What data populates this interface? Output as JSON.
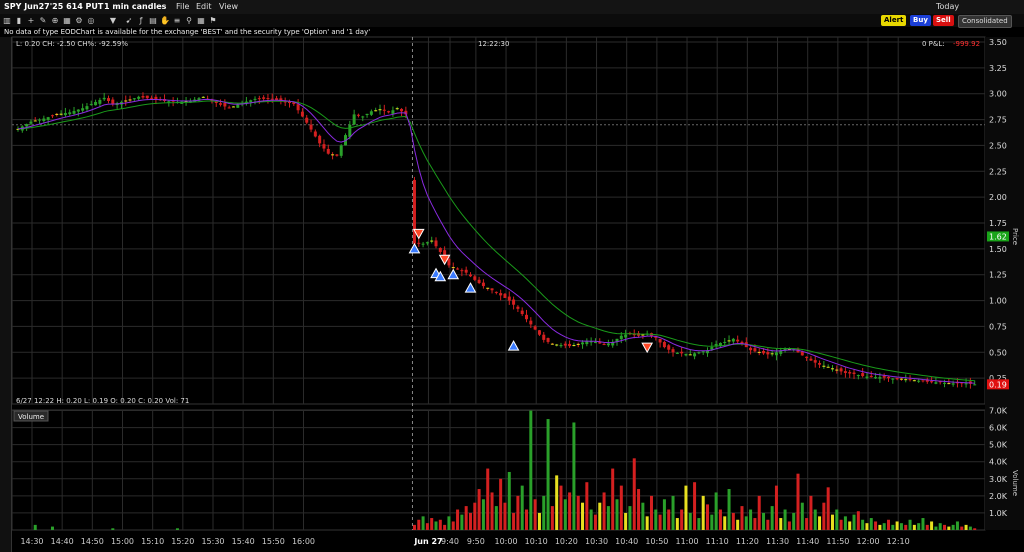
{
  "window": {
    "symbol": "SPY Jun27'25 614 PUT",
    "interval": "1 min candles",
    "menu": [
      "File",
      "Edit",
      "View"
    ],
    "today_label": "Today",
    "consolidated_label": "Consolidated"
  },
  "toolbar": {
    "alert": "Alert",
    "buy": "Buy",
    "sell": "Sell"
  },
  "notice": "No data of type EODChart is available for the exchange 'BEST' and the security type 'Option' and '1 day'",
  "price_panel": {
    "stats": "L: 0.20 CH: -2.50 CH%: -92.59%",
    "cursor_time": "12:22:30",
    "pnl_prefix": "0 P&L:",
    "pnl_value": "-999.92",
    "ohlc_footer": "6/27 12:22  H: 0.20  L: 0.19  O: 0.20  C: 0.20  Vol: 71",
    "last_price_tag": "0.19",
    "green_tag": "1.62",
    "axis_title": "Price"
  },
  "volume_panel": {
    "title": "Volume",
    "axis_title": "Volume"
  },
  "colors": {
    "up": "#2aa02a",
    "down": "#d42020",
    "neutral": "#e8e020",
    "ema_fast": "#8a2be2",
    "ema_slow": "#1a9a1a",
    "sell_tag": "#e01010",
    "grid": "#2b2b2b"
  },
  "chart_data": {
    "type": "candlestick",
    "x_tick_labels": [
      "14:30",
      "14:40",
      "14:50",
      "15:00",
      "15:10",
      "15:20",
      "15:30",
      "15:40",
      "15:50",
      "16:00",
      "Jun 27",
      "9:40",
      "9:50",
      "10:00",
      "10:10",
      "10:20",
      "10:30",
      "10:40",
      "10:50",
      "11:00",
      "11:10",
      "11:20",
      "11:30",
      "11:40",
      "11:50",
      "12:00",
      "12:10"
    ],
    "price_axis": {
      "ylim": [
        0.0,
        3.5
      ],
      "ticks": [
        "3.50",
        "3.25",
        "3.00",
        "2.75",
        "2.50",
        "2.25",
        "2.00",
        "1.75",
        "1.50",
        "1.25",
        "1.00",
        "0.75",
        "0.50",
        "0.25"
      ]
    },
    "volume_axis": {
      "ylim": [
        0,
        7500
      ],
      "ticks": [
        "7.0K",
        "6.0K",
        "5.0K",
        "4.0K",
        "3.0K",
        "2.0K",
        "1.0K"
      ]
    },
    "close_series": {
      "name": "Close",
      "points": [
        [
          0,
          2.66
        ],
        [
          3,
          2.73
        ],
        [
          6,
          2.76
        ],
        [
          9,
          2.8
        ],
        [
          12,
          2.82
        ],
        [
          15,
          2.86
        ],
        [
          18,
          2.92
        ],
        [
          20,
          2.96
        ],
        [
          22,
          2.9
        ],
        [
          25,
          2.93
        ],
        [
          28,
          2.97
        ],
        [
          31,
          2.95
        ],
        [
          34,
          2.93
        ],
        [
          37,
          2.92
        ],
        [
          40,
          2.93
        ],
        [
          43,
          2.97
        ],
        [
          46,
          2.91
        ],
        [
          49,
          2.86
        ],
        [
          52,
          2.91
        ],
        [
          55,
          2.95
        ],
        [
          58,
          2.95
        ],
        [
          61,
          2.93
        ],
        [
          64,
          2.9
        ],
        [
          67,
          2.72
        ],
        [
          70,
          2.52
        ],
        [
          72,
          2.42
        ],
        [
          74,
          2.4
        ],
        [
          76,
          2.6
        ],
        [
          78,
          2.8
        ],
        [
          80,
          2.78
        ],
        [
          82,
          2.83
        ],
        [
          84,
          2.85
        ],
        [
          86,
          2.82
        ],
        [
          88,
          2.86
        ],
        [
          90,
          2.8
        ],
        [
          92,
          1.55
        ],
        [
          94,
          1.55
        ],
        [
          96,
          1.58
        ],
        [
          98,
          1.47
        ],
        [
          100,
          1.34
        ],
        [
          102,
          1.3
        ],
        [
          104,
          1.27
        ],
        [
          106,
          1.2
        ],
        [
          108,
          1.14
        ],
        [
          110,
          1.1
        ],
        [
          112,
          1.05
        ],
        [
          114,
          1.0
        ],
        [
          116,
          0.92
        ],
        [
          118,
          0.82
        ],
        [
          120,
          0.72
        ],
        [
          122,
          0.62
        ],
        [
          124,
          0.58
        ],
        [
          126,
          0.57
        ],
        [
          128,
          0.56
        ],
        [
          130,
          0.58
        ],
        [
          132,
          0.61
        ],
        [
          134,
          0.6
        ],
        [
          136,
          0.57
        ],
        [
          138,
          0.6
        ],
        [
          140,
          0.66
        ],
        [
          142,
          0.68
        ],
        [
          144,
          0.66
        ],
        [
          146,
          0.68
        ],
        [
          148,
          0.64
        ],
        [
          150,
          0.55
        ],
        [
          152,
          0.5
        ],
        [
          154,
          0.49
        ],
        [
          156,
          0.48
        ],
        [
          158,
          0.5
        ],
        [
          160,
          0.52
        ],
        [
          162,
          0.58
        ],
        [
          164,
          0.6
        ],
        [
          166,
          0.63
        ],
        [
          168,
          0.58
        ],
        [
          170,
          0.52
        ],
        [
          172,
          0.5
        ],
        [
          174,
          0.48
        ],
        [
          176,
          0.5
        ],
        [
          178,
          0.54
        ],
        [
          180,
          0.53
        ],
        [
          182,
          0.47
        ],
        [
          184,
          0.42
        ],
        [
          186,
          0.38
        ],
        [
          188,
          0.36
        ],
        [
          190,
          0.33
        ],
        [
          192,
          0.3
        ],
        [
          194,
          0.29
        ],
        [
          196,
          0.27
        ],
        [
          198,
          0.26
        ],
        [
          200,
          0.26
        ],
        [
          202,
          0.25
        ],
        [
          204,
          0.24
        ],
        [
          206,
          0.24
        ],
        [
          208,
          0.23
        ],
        [
          210,
          0.22
        ],
        [
          212,
          0.21
        ],
        [
          214,
          0.21
        ],
        [
          216,
          0.2
        ],
        [
          218,
          0.2
        ],
        [
          220,
          0.2
        ],
        [
          222,
          0.19
        ]
      ]
    },
    "volume_series": [
      {
        "color": "green",
        "values": [
          0,
          0,
          0,
          0,
          300,
          0,
          0,
          0,
          200,
          0,
          0,
          0,
          0,
          0,
          0,
          0,
          0,
          0,
          0,
          0,
          0,
          0,
          100,
          0,
          0,
          0,
          0,
          0,
          0,
          0,
          0,
          0,
          0,
          0,
          0,
          0,
          0,
          100,
          0,
          0,
          0,
          0,
          0,
          0,
          0,
          0,
          0,
          0,
          0,
          0,
          0,
          0,
          0,
          0,
          0,
          0,
          0,
          0,
          0,
          0,
          0,
          0,
          0,
          0,
          0,
          0,
          0,
          0,
          0,
          0,
          0,
          0,
          0,
          0,
          0,
          0,
          0,
          0,
          0,
          0,
          0,
          0,
          0,
          0,
          0,
          0,
          0,
          0,
          0,
          0,
          0,
          0
        ]
      },
      {
        "color": "mixed",
        "bars": [
          [
            92,
            300,
            "red"
          ],
          [
            93,
            600,
            "red"
          ],
          [
            94,
            800,
            "green"
          ],
          [
            95,
            400,
            "red"
          ],
          [
            96,
            700,
            "red"
          ],
          [
            97,
            500,
            "green"
          ],
          [
            98,
            600,
            "red"
          ],
          [
            99,
            300,
            "red"
          ],
          [
            100,
            800,
            "green"
          ],
          [
            101,
            500,
            "red"
          ],
          [
            102,
            1200,
            "red"
          ],
          [
            103,
            900,
            "green"
          ],
          [
            104,
            1400,
            "red"
          ],
          [
            105,
            1000,
            "red"
          ],
          [
            106,
            1600,
            "red"
          ],
          [
            107,
            2400,
            "red"
          ],
          [
            108,
            1800,
            "green"
          ],
          [
            109,
            3600,
            "red"
          ],
          [
            110,
            2200,
            "red"
          ],
          [
            111,
            1400,
            "green"
          ],
          [
            112,
            3000,
            "red"
          ],
          [
            113,
            1600,
            "red"
          ],
          [
            114,
            3400,
            "green"
          ],
          [
            115,
            1000,
            "red"
          ],
          [
            116,
            2000,
            "red"
          ],
          [
            117,
            2600,
            "green"
          ],
          [
            118,
            1200,
            "red"
          ],
          [
            119,
            7000,
            "green"
          ],
          [
            120,
            1800,
            "red"
          ],
          [
            121,
            1000,
            "yellow"
          ],
          [
            122,
            2000,
            "green"
          ],
          [
            123,
            6500,
            "green"
          ],
          [
            124,
            1400,
            "red"
          ],
          [
            125,
            3200,
            "yellow"
          ],
          [
            126,
            2600,
            "red"
          ],
          [
            127,
            1800,
            "green"
          ],
          [
            128,
            2200,
            "red"
          ],
          [
            129,
            6300,
            "green"
          ],
          [
            130,
            2000,
            "red"
          ],
          [
            131,
            1600,
            "yellow"
          ],
          [
            132,
            2800,
            "red"
          ],
          [
            133,
            1200,
            "green"
          ],
          [
            134,
            900,
            "red"
          ],
          [
            135,
            1600,
            "yellow"
          ],
          [
            136,
            2200,
            "red"
          ],
          [
            137,
            1400,
            "green"
          ],
          [
            138,
            3600,
            "red"
          ],
          [
            139,
            1800,
            "green"
          ],
          [
            140,
            2600,
            "red"
          ],
          [
            141,
            1000,
            "yellow"
          ],
          [
            142,
            1400,
            "green"
          ],
          [
            143,
            4200,
            "red"
          ],
          [
            144,
            2400,
            "red"
          ],
          [
            145,
            1600,
            "green"
          ],
          [
            146,
            800,
            "yellow"
          ],
          [
            147,
            2000,
            "red"
          ],
          [
            148,
            1200,
            "green"
          ],
          [
            149,
            900,
            "red"
          ],
          [
            150,
            1800,
            "green"
          ],
          [
            151,
            1200,
            "red"
          ],
          [
            152,
            2000,
            "green"
          ],
          [
            153,
            700,
            "yellow"
          ],
          [
            154,
            1200,
            "red"
          ],
          [
            155,
            2600,
            "yellow"
          ],
          [
            156,
            1000,
            "green"
          ],
          [
            157,
            2800,
            "red"
          ],
          [
            158,
            700,
            "green"
          ],
          [
            159,
            2000,
            "yellow"
          ],
          [
            160,
            1500,
            "red"
          ],
          [
            161,
            900,
            "green"
          ],
          [
            162,
            2200,
            "green"
          ],
          [
            163,
            1200,
            "red"
          ],
          [
            164,
            800,
            "yellow"
          ],
          [
            165,
            2400,
            "green"
          ],
          [
            166,
            1000,
            "red"
          ],
          [
            167,
            600,
            "yellow"
          ],
          [
            168,
            1400,
            "red"
          ],
          [
            169,
            800,
            "green"
          ],
          [
            170,
            1200,
            "green"
          ],
          [
            171,
            700,
            "red"
          ],
          [
            172,
            2000,
            "red"
          ],
          [
            173,
            1000,
            "green"
          ],
          [
            174,
            600,
            "red"
          ],
          [
            175,
            1400,
            "green"
          ],
          [
            176,
            2600,
            "red"
          ],
          [
            177,
            700,
            "yellow"
          ],
          [
            178,
            1200,
            "green"
          ],
          [
            179,
            500,
            "red"
          ],
          [
            180,
            1000,
            "green"
          ],
          [
            181,
            3300,
            "red"
          ],
          [
            182,
            1600,
            "green"
          ],
          [
            183,
            700,
            "red"
          ],
          [
            184,
            2000,
            "red"
          ],
          [
            185,
            1200,
            "green"
          ],
          [
            186,
            800,
            "yellow"
          ],
          [
            187,
            1600,
            "red"
          ],
          [
            188,
            2500,
            "red"
          ],
          [
            189,
            900,
            "yellow"
          ],
          [
            190,
            1200,
            "green"
          ],
          [
            191,
            600,
            "red"
          ],
          [
            192,
            800,
            "green"
          ],
          [
            193,
            500,
            "yellow"
          ],
          [
            194,
            900,
            "green"
          ],
          [
            195,
            1100,
            "red"
          ],
          [
            196,
            600,
            "green"
          ],
          [
            197,
            400,
            "yellow"
          ],
          [
            198,
            700,
            "green"
          ],
          [
            199,
            500,
            "red"
          ],
          [
            200,
            300,
            "yellow"
          ],
          [
            201,
            400,
            "green"
          ],
          [
            202,
            600,
            "red"
          ],
          [
            203,
            300,
            "green"
          ],
          [
            204,
            500,
            "yellow"
          ],
          [
            205,
            400,
            "green"
          ],
          [
            206,
            300,
            "red"
          ],
          [
            207,
            600,
            "green"
          ],
          [
            208,
            300,
            "yellow"
          ],
          [
            209,
            400,
            "green"
          ],
          [
            210,
            700,
            "green"
          ],
          [
            211,
            300,
            "red"
          ],
          [
            212,
            500,
            "yellow"
          ],
          [
            213,
            200,
            "green"
          ],
          [
            214,
            400,
            "green"
          ],
          [
            215,
            300,
            "red"
          ],
          [
            216,
            200,
            "yellow"
          ],
          [
            217,
            300,
            "green"
          ],
          [
            218,
            500,
            "green"
          ],
          [
            219,
            200,
            "red"
          ],
          [
            220,
            300,
            "yellow"
          ],
          [
            221,
            200,
            "green"
          ],
          [
            222,
            100,
            "red"
          ]
        ]
      }
    ],
    "buy_markers": [
      [
        92,
        1.5
      ],
      [
        97,
        1.26
      ],
      [
        98,
        1.23
      ],
      [
        101,
        1.25
      ],
      [
        105,
        1.12
      ],
      [
        115,
        0.56
      ]
    ],
    "sell_markers": [
      [
        93,
        1.65
      ],
      [
        99,
        1.4
      ],
      [
        146,
        0.55
      ]
    ]
  }
}
